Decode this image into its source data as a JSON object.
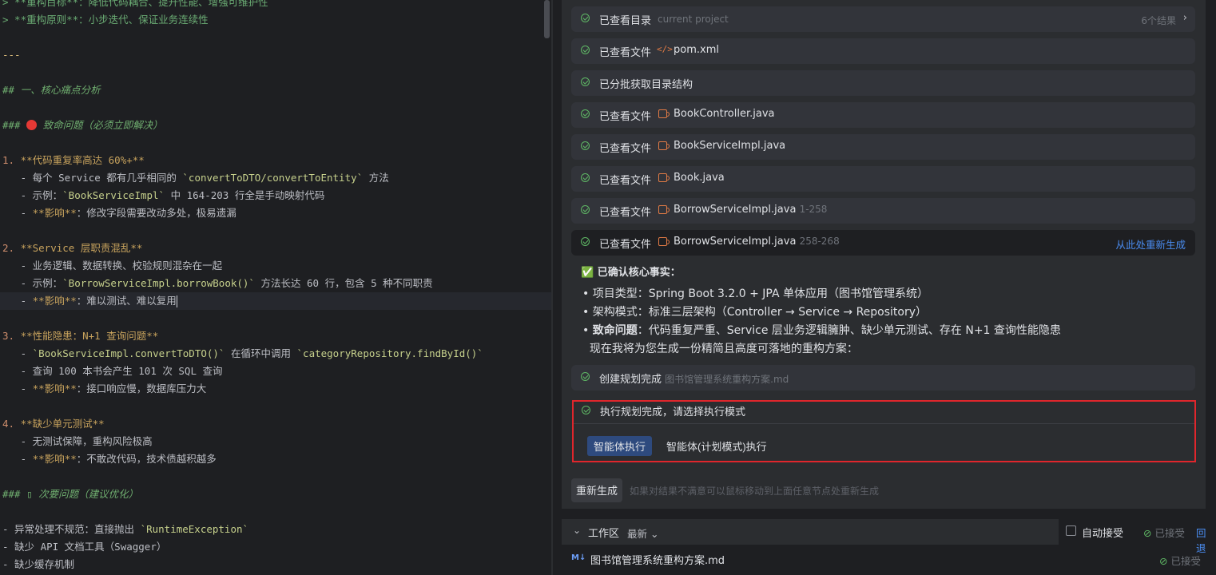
{
  "editor": {
    "lines": [
      [
        [
          "md-quote",
          "> **重构目标**：降低代码耦合、提升性能、增强可维护性"
        ]
      ],
      [
        [
          "md-quote",
          "> **重构原则**：小步迭代、保证业务连续性"
        ]
      ],
      [],
      [
        [
          "md-sym",
          "---"
        ]
      ],
      [],
      [
        [
          "md-h",
          "## 一、核心痛点分析"
        ]
      ],
      [],
      [
        [
          "md-h",
          "### "
        ],
        [
          "dot",
          ""
        ],
        [
          "md-h",
          " 致命问题（必须立即解决）"
        ]
      ],
      [],
      [
        [
          "md-list",
          "1. "
        ],
        [
          "md-bold",
          "**代码重复率高达 60%+**"
        ]
      ],
      [
        [
          "",
          "   - 每个 Service 都有几乎相同的 "
        ],
        [
          "md-code",
          "`convertToDTO/convertToEntity`"
        ],
        [
          "",
          " 方法"
        ]
      ],
      [
        [
          "",
          "   - 示例："
        ],
        [
          "md-code",
          "`BookServiceImpl`"
        ],
        [
          "",
          " 中 164-203 行全是手动映射代码"
        ]
      ],
      [
        [
          "",
          "   - "
        ],
        [
          "md-bold",
          "**影响**"
        ],
        [
          "",
          "：修改字段需要改动多处，极易遗漏"
        ]
      ],
      [],
      [
        [
          "md-list",
          "2. "
        ],
        [
          "md-bold",
          "**Service 层职责混乱**"
        ]
      ],
      [
        [
          "",
          "   - 业务逻辑、数据转换、校验规则混杂在一起"
        ]
      ],
      [
        [
          "",
          "   - 示例："
        ],
        [
          "md-code",
          "`BorrowServiceImpl.borrowBook()`"
        ],
        [
          "",
          " 方法长达 60 行，包含 5 种不同职责"
        ]
      ],
      [
        [
          "",
          "   - "
        ],
        [
          "md-bold",
          "**影响**"
        ],
        [
          "",
          "：难以测试、难以复用"
        ],
        [
          "caret",
          ""
        ]
      ],
      [],
      [
        [
          "md-list",
          "3. "
        ],
        [
          "md-bold",
          "**性能隐患：N+1 查询问题**"
        ]
      ],
      [
        [
          "",
          "   - "
        ],
        [
          "md-code",
          "`BookServiceImpl.convertToDTO()`"
        ],
        [
          "",
          " 在循环中调用 "
        ],
        [
          "md-code",
          "`categoryRepository.findById()`"
        ]
      ],
      [
        [
          "",
          "   - 查询 100 本书会产生 101 次 SQL 查询"
        ]
      ],
      [
        [
          "",
          "   - "
        ],
        [
          "md-bold",
          "**影响**"
        ],
        [
          "",
          "：接口响应慢，数据库压力大"
        ]
      ],
      [],
      [
        [
          "md-list",
          "4. "
        ],
        [
          "md-bold",
          "**缺少单元测试**"
        ]
      ],
      [
        [
          "",
          "   - 无测试保障，重构风险极高"
        ]
      ],
      [
        [
          "",
          "   - "
        ],
        [
          "md-bold",
          "**影响**"
        ],
        [
          "",
          "：不敢改代码，技术债越积越多"
        ]
      ],
      [],
      [
        [
          "md-h",
          "### ▯ 次要问题（建议优化）"
        ]
      ],
      [],
      [
        [
          "",
          "- 异常处理不规范：直接抛出 "
        ],
        [
          "md-code",
          "`RuntimeException`"
        ]
      ],
      [
        [
          "",
          "- 缺少 API 文档工具（Swagger）"
        ]
      ],
      [
        [
          "",
          "- 缺少缓存机制"
        ]
      ]
    ]
  },
  "steps": [
    {
      "label": "已查看目录",
      "file": "",
      "icon": "",
      "extra": "current project",
      "right": "6个结果",
      "chevron": "›",
      "link": ""
    },
    {
      "label": "已查看文件",
      "file": "pom.xml",
      "icon": "xml",
      "extra": "",
      "right": "",
      "chevron": "",
      "link": ""
    },
    {
      "label": "已分批获取目录结构",
      "file": "",
      "icon": "",
      "extra": "",
      "right": "",
      "chevron": "",
      "link": ""
    },
    {
      "label": "已查看文件",
      "file": "BookController.java",
      "icon": "java",
      "extra": "",
      "right": "",
      "chevron": "",
      "link": ""
    },
    {
      "label": "已查看文件",
      "file": "BookServiceImpl.java",
      "icon": "java",
      "extra": "",
      "right": "",
      "chevron": "",
      "link": ""
    },
    {
      "label": "已查看文件",
      "file": "Book.java",
      "icon": "java",
      "extra": "",
      "right": "",
      "chevron": "",
      "link": ""
    },
    {
      "label": "已查看文件",
      "file": "BorrowServiceImpl.java",
      "icon": "java",
      "extra": "1-258",
      "right": "",
      "chevron": "",
      "link": ""
    },
    {
      "label": "已查看文件",
      "file": "BorrowServiceImpl.java",
      "icon": "java",
      "extra": "258-268",
      "right": "",
      "chevron": "",
      "link": "从此处重新生成"
    }
  ],
  "facts": {
    "title": "✅ 已确认核心事实：",
    "items": [
      {
        "bullet": "• ",
        "bold": "",
        "text": "项目类型：Spring Boot 3.2.0 + JPA 单体应用（图书馆管理系统）"
      },
      {
        "bullet": "• ",
        "bold": "",
        "text": "架构模式：标准三层架构（Controller → Service → Repository）"
      },
      {
        "bullet": "• ",
        "bold": "致命问题",
        "text": "：代码重复严重、Service 层业务逻辑臃肿、缺少单元测试、存在 N+1 查询性能隐患"
      },
      {
        "bullet": "",
        "bold": "",
        "text": "  现在我将为您生成一份精简且高度可落地的重构方案："
      }
    ]
  },
  "plan_step": {
    "label": "创建规划完成",
    "extra": "图书馆管理系统重构方案.md"
  },
  "exec": {
    "label": "执行规划完成，请选择执行模式",
    "agent_btn": "智能体执行",
    "plan_btn": "智能体(计划模式)执行"
  },
  "regen": {
    "button": "重新生成",
    "hint": "如果对结果不满意可以鼠标移动到上面任意节点处重新生成"
  },
  "workspace": {
    "chevron": "⌄",
    "label": "工作区",
    "latest": "最新 ⌄",
    "auto_accept": "自动接受",
    "accepted_mark": "⊘",
    "accepted": "已接受",
    "undo": "回退",
    "file_icon": "M↓",
    "file": "图书馆管理系统重构方案.md",
    "file_status": "已接受"
  },
  "colors": {
    "accent": "#4a8cf0",
    "success": "#5fb865",
    "highlight_border": "#e0262c",
    "primary_button": "#2e4a7e"
  }
}
